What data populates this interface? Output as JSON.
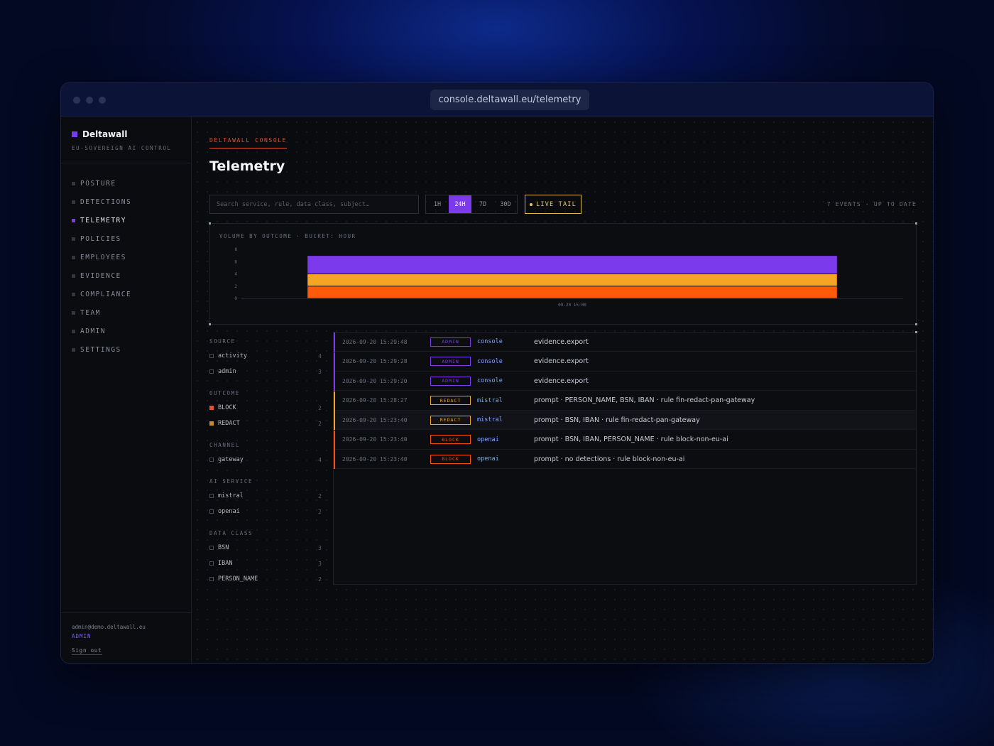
{
  "browser": {
    "url": "console.deltawall.eu/telemetry"
  },
  "brand": {
    "name": "Deltawall",
    "tagline": "EU-SOVEREIGN AI CONTROL",
    "accent": "#7c3aed"
  },
  "nav": [
    {
      "label": "POSTURE",
      "active": false
    },
    {
      "label": "DETECTIONS",
      "active": false
    },
    {
      "label": "TELEMETRY",
      "active": true
    },
    {
      "label": "POLICIES",
      "active": false
    },
    {
      "label": "EMPLOYEES",
      "active": false
    },
    {
      "label": "EVIDENCE",
      "active": false
    },
    {
      "label": "COMPLIANCE",
      "active": false
    },
    {
      "label": "TEAM",
      "active": false
    },
    {
      "label": "ADMIN",
      "active": false
    },
    {
      "label": "SETTINGS",
      "active": false
    }
  ],
  "user": {
    "email": "admin@demo.deltawall.eu",
    "role": "ADMIN",
    "signout": "Sign out"
  },
  "header": {
    "eyebrow": "DELTAWALL CONSOLE",
    "title": "Telemetry"
  },
  "toolbar": {
    "search_placeholder": "Search service, rule, data class, subject…",
    "ranges": [
      {
        "label": "1H",
        "active": false
      },
      {
        "label": "24H",
        "active": true
      },
      {
        "label": "7D",
        "active": false
      },
      {
        "label": "30D",
        "active": false
      }
    ],
    "live_label": "LIVE TAIL",
    "status": "7 EVENTS · UP TO DATE"
  },
  "chart_data": {
    "type": "bar",
    "stacked": true,
    "title": "VOLUME BY OUTCOME · BUCKET: HOUR",
    "categories": [
      "09-20 15:00"
    ],
    "series": [
      {
        "outcome": "BLOCK",
        "color": "#ff5a0a",
        "values": [
          2
        ]
      },
      {
        "outcome": "REDACT",
        "color": "#f5a524",
        "values": [
          2
        ]
      },
      {
        "outcome": "ADMIN",
        "color": "#7c3aed",
        "values": [
          3
        ]
      }
    ],
    "yticks": [
      0,
      2,
      4,
      6,
      8
    ],
    "ylim": [
      0,
      8
    ],
    "grid": false,
    "legend": "none"
  },
  "facets": [
    {
      "title": "SOURCE",
      "items": [
        {
          "label": "activity",
          "count": "4"
        },
        {
          "label": "admin",
          "count": "3"
        }
      ]
    },
    {
      "title": "OUTCOME",
      "items": [
        {
          "label": "BLOCK",
          "count": "2",
          "swatch": "#e0532a"
        },
        {
          "label": "REDACT",
          "count": "2",
          "swatch": "#c98a2a"
        }
      ]
    },
    {
      "title": "CHANNEL",
      "items": [
        {
          "label": "gateway",
          "count": "4"
        }
      ]
    },
    {
      "title": "AI SERVICE",
      "items": [
        {
          "label": "mistral",
          "count": "2"
        },
        {
          "label": "openai",
          "count": "2"
        }
      ]
    },
    {
      "title": "DATA CLASS",
      "items": [
        {
          "label": "BSN",
          "count": "3"
        },
        {
          "label": "IBAN",
          "count": "3"
        },
        {
          "label": "PERSON_NAME",
          "count": "2"
        }
      ]
    }
  ],
  "outcome_colors": {
    "ADMIN": "#7c3aed",
    "REDACT": "#f5a524",
    "BLOCK": "#ff4d0a"
  },
  "events": [
    {
      "time": "2026-09-20 15:29:48",
      "outcome": "ADMIN",
      "service": "console",
      "summary": "evidence.export"
    },
    {
      "time": "2026-09-20 15:29:28",
      "outcome": "ADMIN",
      "service": "console",
      "summary": "evidence.export"
    },
    {
      "time": "2026-09-20 15:29:20",
      "outcome": "ADMIN",
      "service": "console",
      "summary": "evidence.export"
    },
    {
      "time": "2026-09-20 15:28:27",
      "outcome": "REDACT",
      "service": "mistral",
      "summary": "prompt · PERSON_NAME, BSN, IBAN · rule fin-redact-pan-gateway"
    },
    {
      "time": "2026-09-20 15:23:40",
      "outcome": "REDACT",
      "service": "mistral",
      "summary": "prompt · BSN, IBAN · rule fin-redact-pan-gateway",
      "highlighted": true
    },
    {
      "time": "2026-09-20 15:23:40",
      "outcome": "BLOCK",
      "service": "openai",
      "summary": "prompt · BSN, IBAN, PERSON_NAME · rule block-non-eu-ai"
    },
    {
      "time": "2026-09-20 15:23:40",
      "outcome": "BLOCK",
      "service": "openai",
      "summary": "prompt · no detections · rule block-non-eu-ai"
    }
  ]
}
